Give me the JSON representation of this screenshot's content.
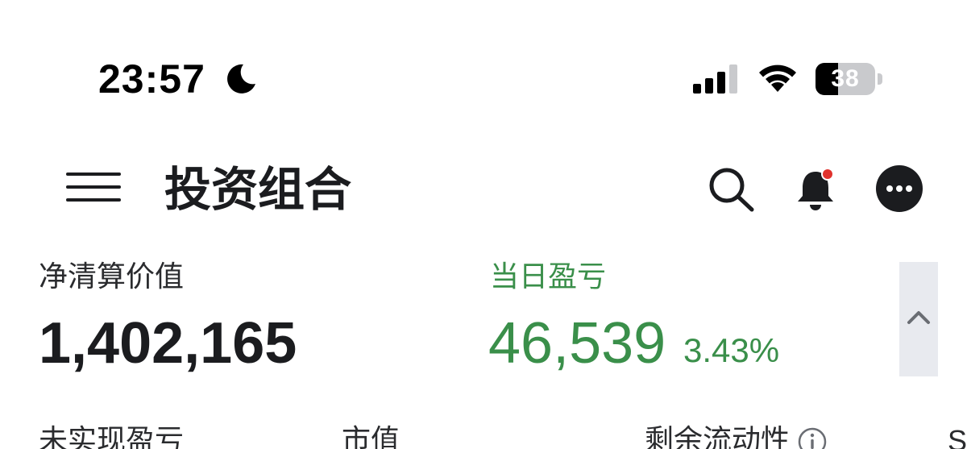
{
  "status_bar": {
    "time": "23:57",
    "battery_level": "38",
    "battery_fraction": 0.38
  },
  "header": {
    "title": "投资组合",
    "icons": [
      "menu-icon",
      "search-icon",
      "bell-icon",
      "more-icon"
    ],
    "notification_dot_color": "#e0322d"
  },
  "summary": {
    "net_liquidation": {
      "label": "净清算价值",
      "value": "1,402,165"
    },
    "daily_pnl": {
      "label": "当日盈亏",
      "value": "46,539",
      "percent": "3.43%",
      "color": "#3a8f4a"
    }
  },
  "metrics_row": {
    "unrealized_pnl_label": "未实现盈亏",
    "market_value_label": "市值",
    "excess_liquidity_label": "剩余流动性",
    "sma_label": "SI"
  }
}
